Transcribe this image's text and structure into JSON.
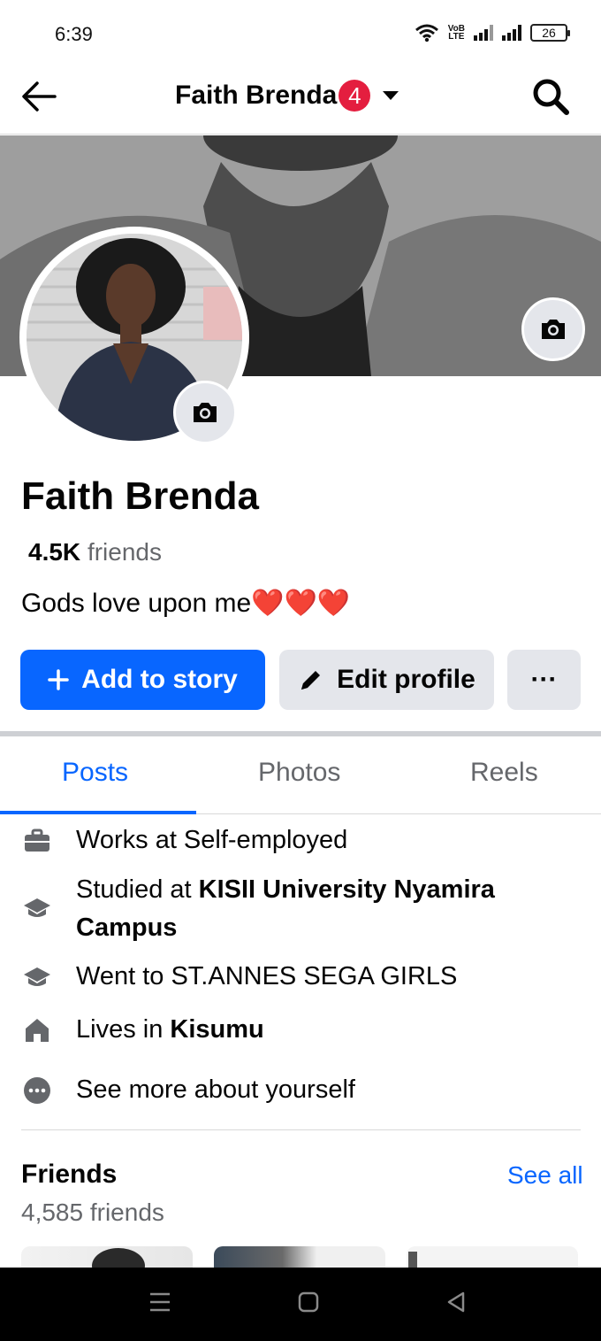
{
  "status_bar": {
    "time": "6:39",
    "volte": "VoB\nLTE",
    "battery": "26"
  },
  "header": {
    "title": "Faith Brenda",
    "notification_count": "4"
  },
  "profile": {
    "name": "Faith Brenda",
    "friends_count": "4.5K",
    "friends_word": "friends",
    "bio_text": "Gods love upon me",
    "bio_hearts": "❤️❤️❤️"
  },
  "actions": {
    "add_story": "Add to story",
    "edit_profile": "Edit profile",
    "more": "···"
  },
  "tabs": [
    "Posts",
    "Photos",
    "Reels"
  ],
  "intro": {
    "work_prefix": "Works at Self-employed",
    "studied_prefix": "Studied at ",
    "studied_school": "KISII University Nyamira Campus",
    "went_to": "Went to ST.ANNES SEGA GIRLS",
    "lives_prefix": "Lives in ",
    "lives_city": "Kisumu",
    "see_more": "See more about yourself"
  },
  "friends": {
    "title": "Friends",
    "see_all": "See all",
    "count_text": "4,585 friends"
  },
  "colors": {
    "accent": "#0866ff",
    "badge": "#e41e3f",
    "secondary_bg": "#e4e6eb"
  }
}
